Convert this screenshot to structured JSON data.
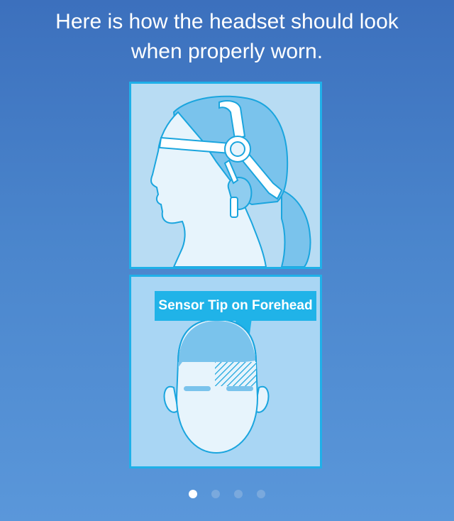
{
  "instruction": {
    "text": "Here is how the headset should look when properly worn."
  },
  "illustrations": {
    "side_view": {
      "icon": "headset-side-view-illustration"
    },
    "front_view": {
      "icon": "headset-front-view-illustration",
      "callout_label": "Sensor Tip on Forehead"
    }
  },
  "pager": {
    "page_count": 4,
    "current_page": 1
  },
  "colors": {
    "background_top": "#3c70bd",
    "background_bottom": "#5a97da",
    "panel_border": "#1fb0e8",
    "callout_fill": "#20b3e8",
    "dot_active": "#ffffff",
    "dot_inactive": "#7aa9dd"
  }
}
